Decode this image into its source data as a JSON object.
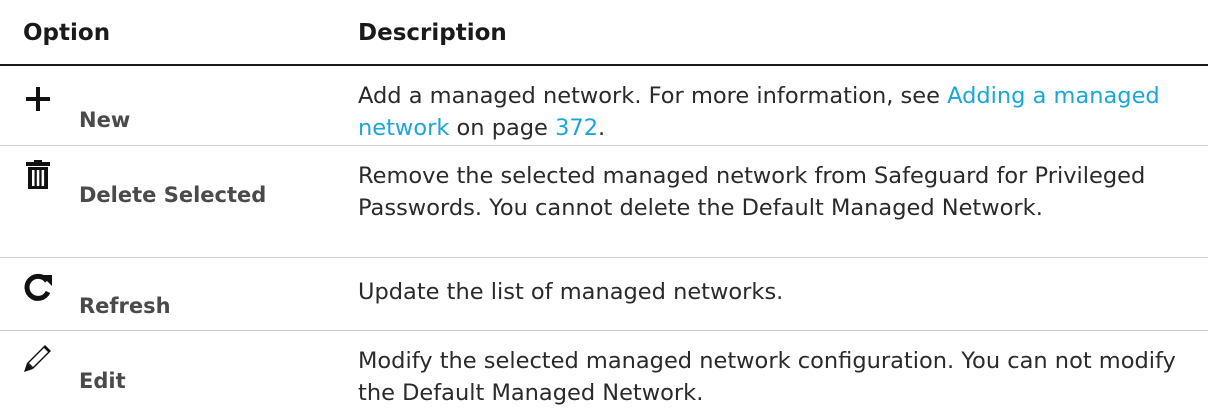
{
  "table": {
    "headers": {
      "option": "Option",
      "description": "Description"
    },
    "rows": [
      {
        "icon": "plus-icon",
        "label": "New",
        "desc_text_before": "Add a managed network. For more information, see ",
        "desc_link_title": "Adding a managed network",
        "desc_text_middle": " on page ",
        "desc_link_page": "372",
        "desc_text_after": "."
      },
      {
        "icon": "trash-icon",
        "label": "Delete Selected",
        "desc": "Remove the selected managed network from Safeguard for Privileged Passwords. You cannot delete the Default Managed Network."
      },
      {
        "icon": "refresh-icon",
        "label": "Refresh",
        "desc": "Update the list of managed networks."
      },
      {
        "icon": "pencil-icon",
        "label": "Edit",
        "desc": "Modify the selected managed network configuration. You can not modify the Default Managed Network."
      }
    ]
  },
  "colors": {
    "link": "#1ba6d8",
    "label": "#4a4a4a",
    "text": "#2a2a2a"
  }
}
